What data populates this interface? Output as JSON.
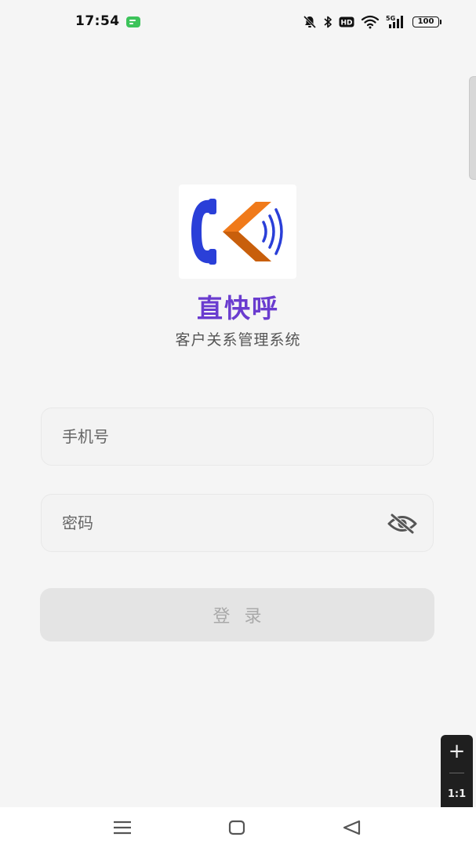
{
  "status_bar": {
    "time": "17:54",
    "battery": "100",
    "hd_badge": "HD",
    "network": "5G",
    "icons": [
      "message-icon",
      "mute-icon",
      "bluetooth-icon",
      "hd-icon",
      "wifi-icon",
      "signal-5g-icon",
      "battery-icon"
    ]
  },
  "brand": {
    "app_name": "直快呼",
    "subtitle": "客户关系管理系统",
    "colors": {
      "app_name": "#6a3ccf",
      "logo_blue": "#2a3fd8",
      "logo_orange": "#f07a1a"
    }
  },
  "form": {
    "phone": {
      "placeholder": "手机号",
      "value": ""
    },
    "password": {
      "placeholder": "密码",
      "value": ""
    },
    "login_label": "登录"
  },
  "zoom_control": {
    "plus": "+",
    "ratio": "1:1"
  },
  "nav_bar": {
    "buttons": [
      "menu-icon",
      "home-icon",
      "back-icon"
    ]
  }
}
